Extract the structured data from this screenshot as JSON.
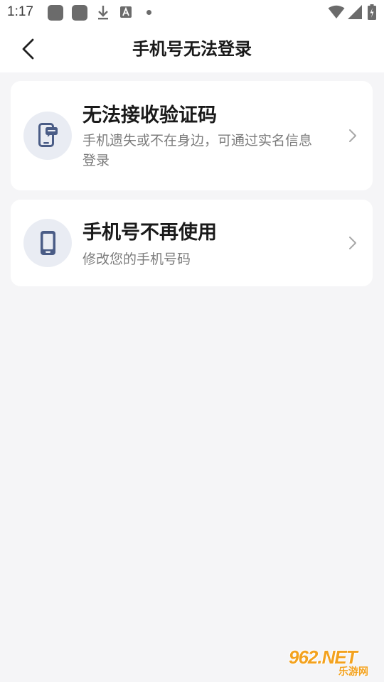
{
  "status_bar": {
    "time": "1:17",
    "icons": [
      "app-square-icon",
      "app-square-icon",
      "download-icon",
      "font-a-icon",
      "dot-icon",
      "wifi-icon",
      "cellular-signal-icon",
      "battery-icon"
    ]
  },
  "header": {
    "title": "手机号无法登录",
    "back_icon": "chevron-left-icon"
  },
  "options": [
    {
      "title": "无法接收验证码",
      "description": "手机遗失或不在身边，可通过实名信息登录",
      "icon": "phone-message-icon"
    },
    {
      "title": "手机号不再使用",
      "description": "修改您的手机号码",
      "icon": "phone-icon"
    }
  ],
  "watermark": {
    "main": "962.NET",
    "sub": "乐游网"
  },
  "colors": {
    "background": "#f5f5f7",
    "card": "#ffffff",
    "icon_circle": "#e9ecf3",
    "icon_fill": "#4a5c86",
    "title_text": "#1a1a1a",
    "desc_text": "#7c7c7c",
    "watermark": "#f3a21f"
  }
}
